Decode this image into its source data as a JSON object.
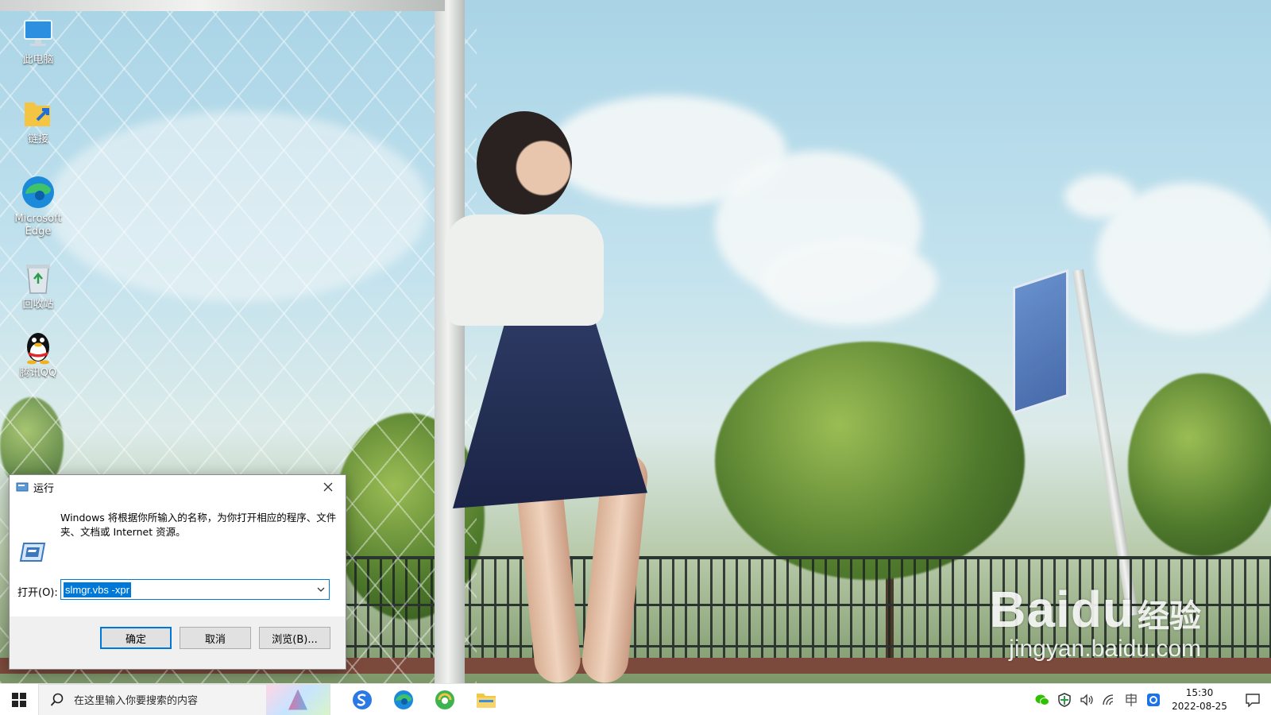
{
  "desktop": {
    "icons": [
      {
        "label": "此电脑",
        "icon": "this-pc-icon"
      },
      {
        "label": "链接",
        "icon": "links-folder-icon"
      },
      {
        "label": "Microsoft Edge",
        "icon": "edge-icon"
      },
      {
        "label": "回收站",
        "icon": "recycle-bin-icon"
      },
      {
        "label": "腾讯QQ",
        "icon": "qq-icon"
      }
    ]
  },
  "run_dialog": {
    "title": "运行",
    "description": "Windows 将根据你所输入的名称，为你打开相应的程序、文件夹、文档或 Internet 资源。",
    "open_label": "打开(O):",
    "input_value": "slmgr.vbs -xpr",
    "ok_label": "确定",
    "cancel_label": "取消",
    "browse_label": "浏览(B)..."
  },
  "taskbar": {
    "search_placeholder": "在这里输入你要搜索的内容",
    "pinned_apps": [
      "sogou-browser-icon",
      "edge-icon",
      "360-browser-icon",
      "file-explorer-icon"
    ],
    "time": "15:30",
    "date": "2022-08-25",
    "tray_icons": [
      "wechat-icon",
      "security-shield-icon",
      "volume-icon",
      "network-icon",
      "ime-icon",
      "app-tray-icon"
    ]
  },
  "watermark": {
    "logo": "Bai",
    "logo_mid": "du",
    "logo_sub": "经验",
    "url": "jingyan.baidu.com"
  },
  "colors": {
    "accent": "#0078d7",
    "taskbar_bg": "#ffffff",
    "dialog_bg": "#f0f0f0"
  }
}
